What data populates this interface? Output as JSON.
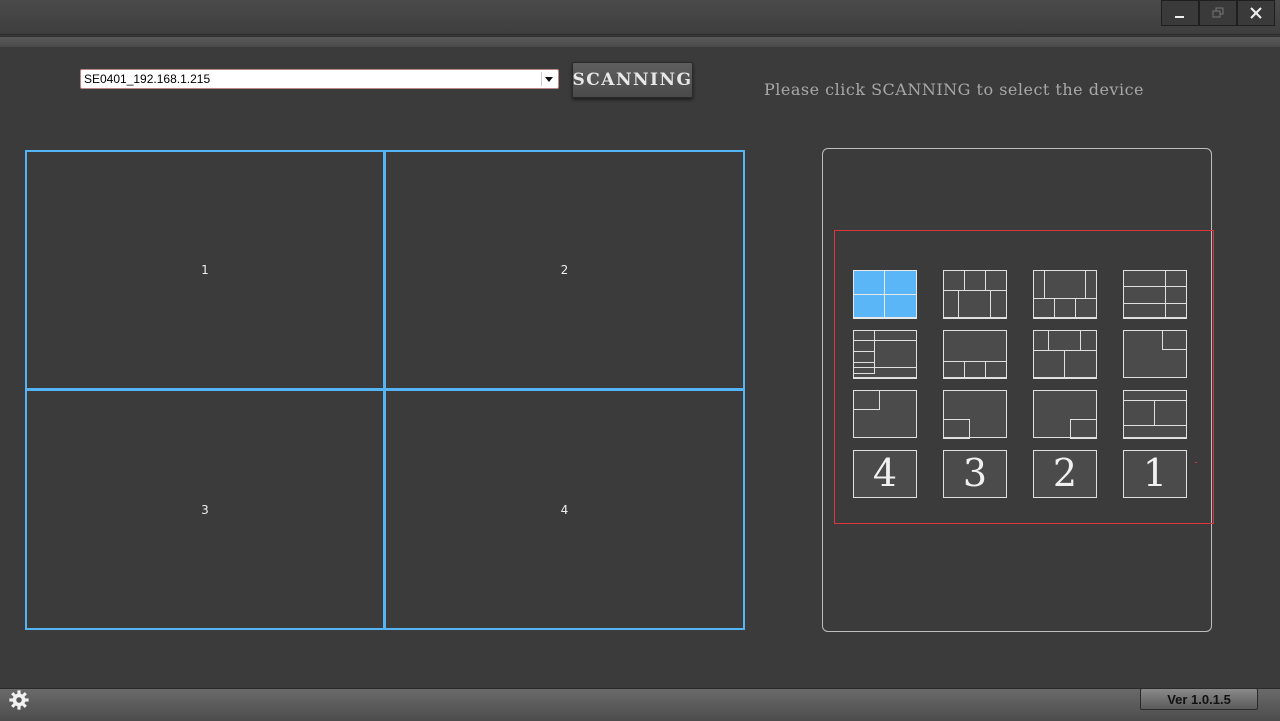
{
  "window": {
    "buttons": [
      {
        "name": "minimize-icon"
      },
      {
        "name": "restore-icon"
      },
      {
        "name": "close-icon"
      }
    ]
  },
  "toolbar": {
    "device_value": "SE0401_192.168.1.215",
    "scan_label": "SCANNING",
    "hint": "Please click SCANNING to select the device"
  },
  "views": [
    {
      "label": "1"
    },
    {
      "label": "2"
    },
    {
      "label": "3"
    },
    {
      "label": "4"
    }
  ],
  "layouts": {
    "selected_index": 0,
    "single_labels": [
      "4",
      "3",
      "2",
      "1"
    ]
  },
  "status": {
    "version": "Ver 1.0.1.5"
  },
  "colors": {
    "accent": "#55b4f5",
    "highlight_border": "#d9373f",
    "background": "#3b3b3b"
  }
}
